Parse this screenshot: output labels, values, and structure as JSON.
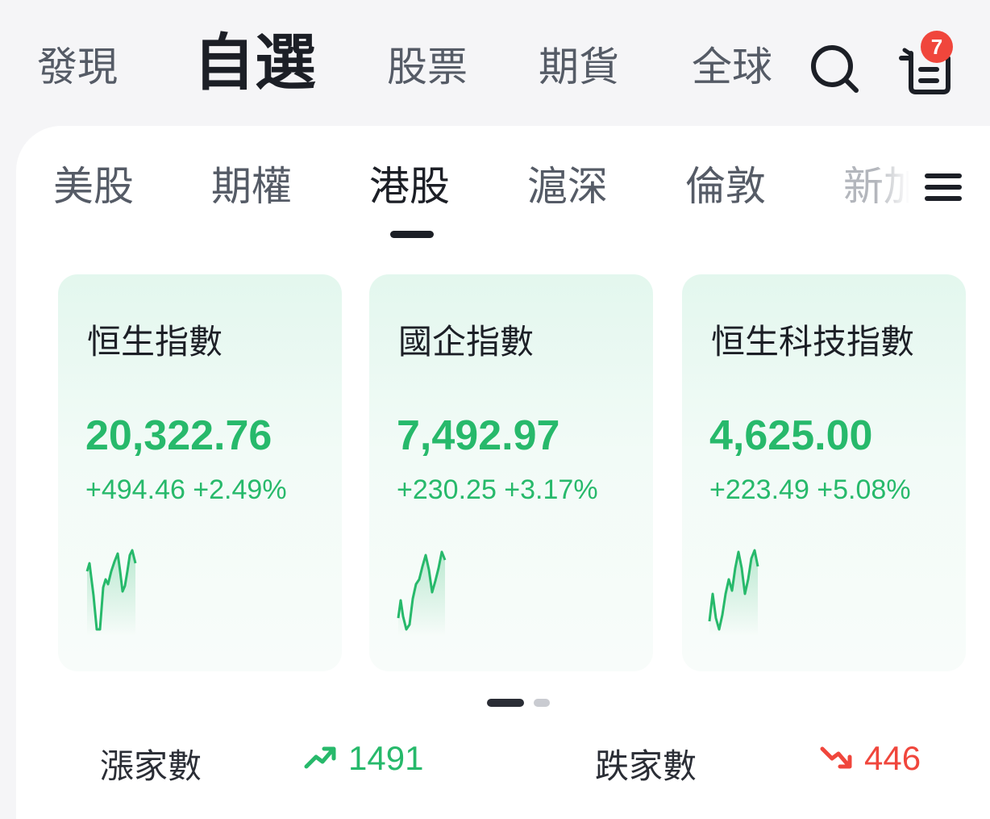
{
  "top_nav": {
    "tabs": [
      {
        "label": "發現",
        "active": false
      },
      {
        "label": "自選",
        "active": true
      },
      {
        "label": "股票",
        "active": false
      },
      {
        "label": "期貨",
        "active": false
      },
      {
        "label": "全球",
        "active": false
      }
    ],
    "search_icon": "search-icon",
    "message_icon": "notification-list-icon",
    "badge_count": "7"
  },
  "market_tabs": {
    "items": [
      {
        "label": "美股",
        "active": false
      },
      {
        "label": "期權",
        "active": false
      },
      {
        "label": "港股",
        "active": true
      },
      {
        "label": "滬深",
        "active": false
      },
      {
        "label": "倫敦",
        "active": false
      },
      {
        "label": "新加",
        "active": false
      }
    ],
    "menu_icon": "hamburger-menu-icon"
  },
  "index_cards": [
    {
      "name": "恒生指數",
      "value": "20,322.76",
      "change": "+494.46 +2.49%",
      "trend": "up"
    },
    {
      "name": "國企指數",
      "value": "7,492.97",
      "change": "+230.25 +3.17%",
      "trend": "up"
    },
    {
      "name": "恒生科技指數",
      "value": "4,625.00",
      "change": "+223.49 +5.08%",
      "trend": "up"
    }
  ],
  "pager": {
    "pages": 2,
    "current": 1
  },
  "stats": {
    "advancers_label": "漲家數",
    "advancers_value": "1491",
    "decliners_label": "跌家數",
    "decliners_value": "446"
  },
  "colors": {
    "up": "#27b96b",
    "down": "#f0463c",
    "badge": "#f0463c",
    "text_dark": "#1c1f26"
  }
}
